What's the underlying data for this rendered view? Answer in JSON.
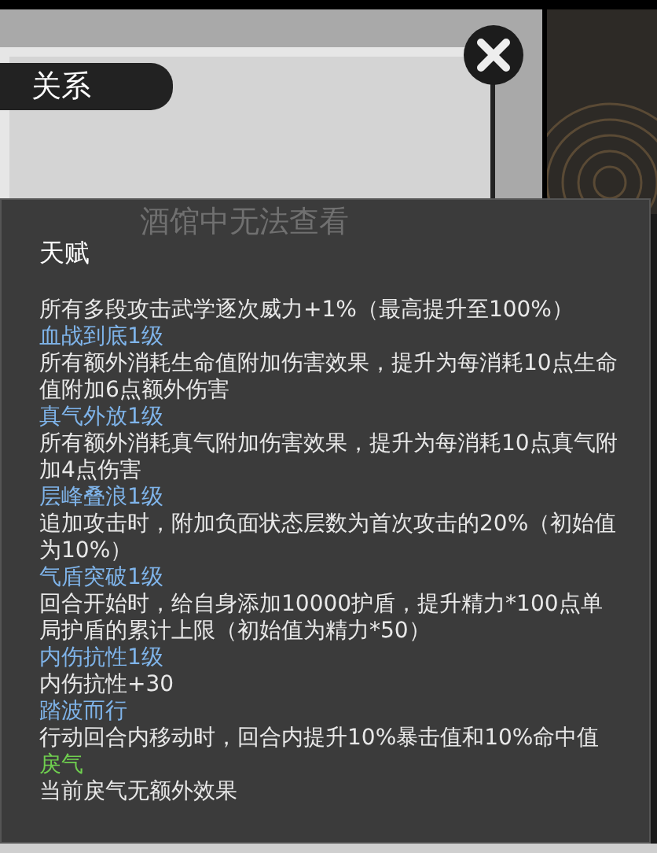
{
  "window": {
    "title": "关系"
  },
  "background_note": "酒馆中无法查看",
  "tooltip": {
    "title": "天赋",
    "entries": [
      {
        "kind": "desc",
        "text": "所有多段攻击武学逐次威力+1%（最高提升至100%）"
      },
      {
        "kind": "name",
        "text": "血战到底1级",
        "color": "#7fb4ea"
      },
      {
        "kind": "desc",
        "text": "所有额外消耗生命值附加伤害效果，提升为每消耗10点生命值附加6点额外伤害"
      },
      {
        "kind": "name",
        "text": "真气外放1级",
        "color": "#7fb4ea"
      },
      {
        "kind": "desc",
        "text": "所有额外消耗真气附加伤害效果，提升为每消耗10点真气附加4点伤害"
      },
      {
        "kind": "name",
        "text": "层峰叠浪1级",
        "color": "#7fb4ea"
      },
      {
        "kind": "desc",
        "text": "追加攻击时，附加负面状态层数为首次攻击的20%（初始值为10%）"
      },
      {
        "kind": "name",
        "text": "气盾突破1级",
        "color": "#7fb4ea"
      },
      {
        "kind": "desc",
        "text": "回合开始时，给自身添加10000护盾，提升精力*100点单局护盾的累计上限（初始值为精力*50）"
      },
      {
        "kind": "name",
        "text": "内伤抗性1级",
        "color": "#7fb4ea"
      },
      {
        "kind": "desc",
        "text": "内伤抗性+30"
      },
      {
        "kind": "name",
        "text": "踏波而行",
        "color": "#7fb4ea"
      },
      {
        "kind": "desc",
        "text": "行动回合内移动时，回合内提升10%暴击值和10%命中值"
      },
      {
        "kind": "name",
        "text": "戾气",
        "color": "#6fcf4f"
      },
      {
        "kind": "desc",
        "text": "当前戾气无额外效果"
      }
    ]
  }
}
